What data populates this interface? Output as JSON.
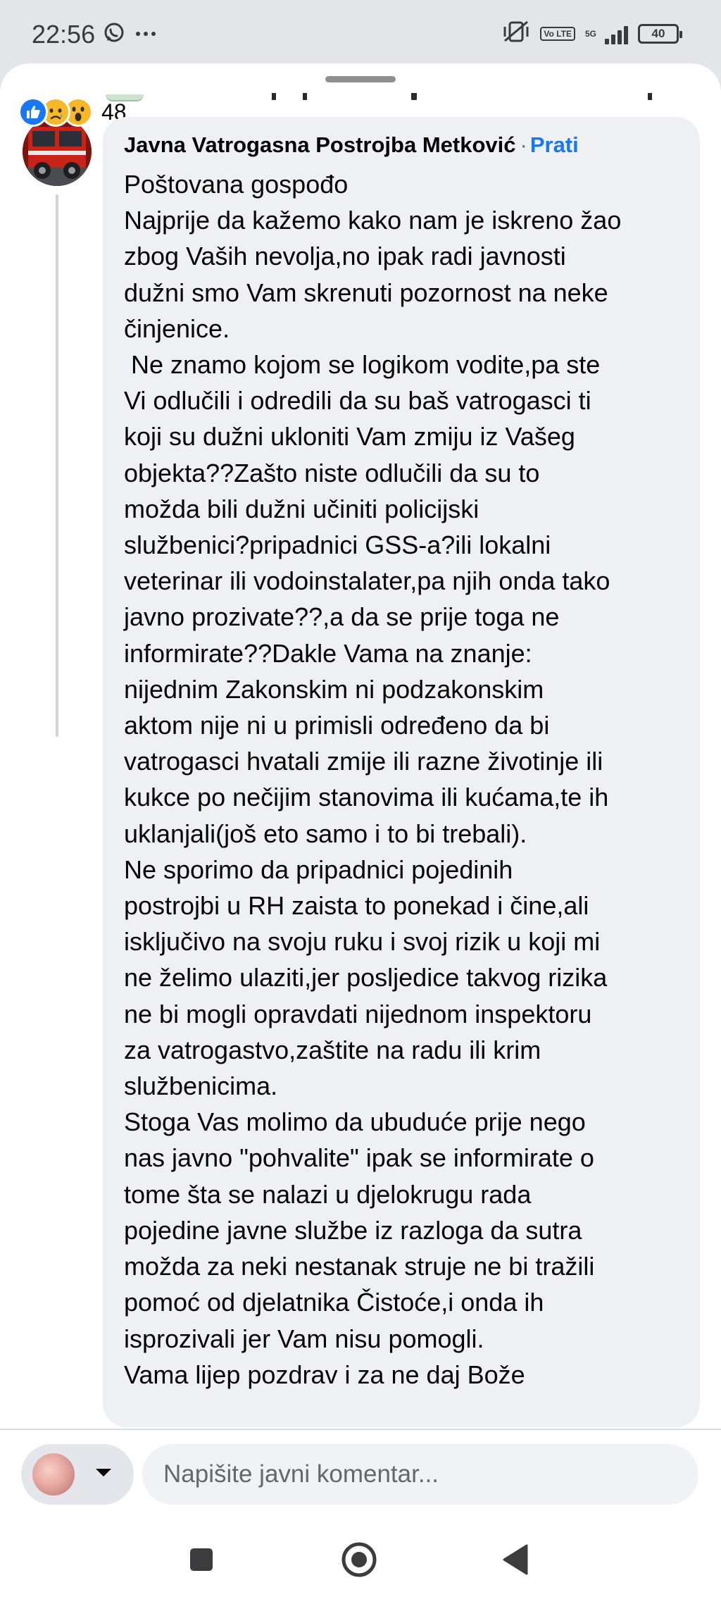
{
  "status_bar": {
    "time": "22:56",
    "network": "5G",
    "lte_label": "Vo LTE",
    "battery": "40"
  },
  "reactions": {
    "count": "48",
    "icons": [
      "like-icon",
      "sad-icon",
      "wow-icon"
    ]
  },
  "comment": {
    "author": "Javna Vatrogasna Postrojba Metković",
    "separator": "·",
    "follow_label": "Prati",
    "lines": [
      "Poštovana gospođo",
      "Najprije da kažemo kako nam je iskreno žao",
      "zbog Vaših nevolja,no ipak radi javnosti",
      "dužni smo Vam skrenuti pozornost na neke",
      "činjenice.",
      " Ne znamo kojom se logikom vodite,pa ste",
      "Vi odlučili i odredili da su baš vatrogasci ti",
      "koji su dužni ukloniti Vam zmiju iz Vašeg",
      "objekta??Zašto niste odlučili da su to",
      "možda bili dužni učiniti policijski",
      "službenici?pripadnici GSS-a?ili lokalni",
      "veterinar ili vodoinstalater,pa njih onda tako",
      "javno prozivate??,a da se prije toga ne",
      "informirate??Dakle Vama na znanje:",
      "nijednim Zakonskim ni podzakonskim",
      "aktom nije ni u primisli određeno da bi",
      "vatrogasci hvatali zmije ili razne životinje ili",
      "kukce po nečijim stanovima ili kućama,te ih",
      "uklanjali(još eto samo i to bi trebali).",
      "Ne sporimo da pripadnici pojedinih",
      "postrojbi u RH zaista to ponekad i čine,ali",
      "isključivo na svoju ruku i svoj rizik u koji mi",
      "ne želimo ulaziti,jer posljedice takvog rizika",
      "ne bi mogli opravdati nijednom inspektoru",
      "za vatrogastvo,zaštite na radu ili krim",
      "službenicima.",
      "Stoga Vas molimo da ubuduće prije nego",
      "nas javno \"pohvalite\" ipak se informirate o",
      "tome šta se nalazi u djelokrugu rada",
      "pojedine javne službe iz razloga da sutra",
      "možda za neki nestanak struje ne bi tražili",
      "pomoć od djelatnika Čistoće,i onda ih",
      "isprozivali jer Vam nisu pomogli.",
      "Vama lijep pozdrav i za ne daj Bože"
    ]
  },
  "composer": {
    "placeholder": "Napišite javni komentar..."
  },
  "colors": {
    "accent": "#1877f2",
    "bubble": "#eff0f3",
    "status_bg": "#e4e5e9"
  }
}
